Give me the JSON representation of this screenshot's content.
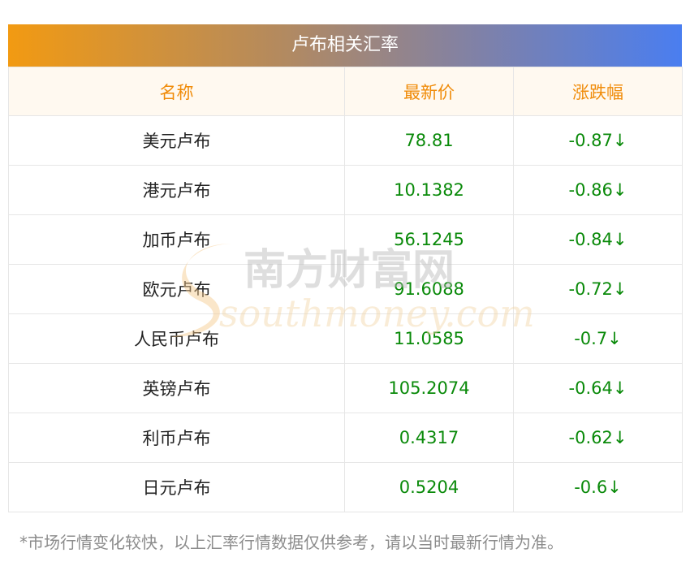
{
  "title": "卢布相关汇率",
  "headers": {
    "name": "名称",
    "price": "最新价",
    "change": "涨跌幅"
  },
  "rows": [
    {
      "name": "美元卢布",
      "price": "78.81",
      "change": "-0.87↓"
    },
    {
      "name": "港元卢布",
      "price": "10.1382",
      "change": "-0.86↓"
    },
    {
      "name": "加币卢布",
      "price": "56.1245",
      "change": "-0.84↓"
    },
    {
      "name": "欧元卢布",
      "price": "91.6088",
      "change": "-0.72↓"
    },
    {
      "name": "人民币卢布",
      "price": "11.0585",
      "change": "-0.7↓"
    },
    {
      "name": "英镑卢布",
      "price": "105.2074",
      "change": "-0.64↓"
    },
    {
      "name": "利币卢布",
      "price": "0.4317",
      "change": "-0.62↓"
    },
    {
      "name": "日元卢布",
      "price": "0.5204",
      "change": "-0.6↓"
    }
  ],
  "note": "*市场行情变化较快，以上汇率行情数据仅供参考，请以当时最新行情为准。",
  "watermark": {
    "cn": "南方财富网",
    "en": "southmoney.com"
  },
  "colors": {
    "header_text": "#f08c0a",
    "value_text": "#0a8a0a",
    "gradient_start": "#f29a12",
    "gradient_end": "#4a7ef0"
  }
}
